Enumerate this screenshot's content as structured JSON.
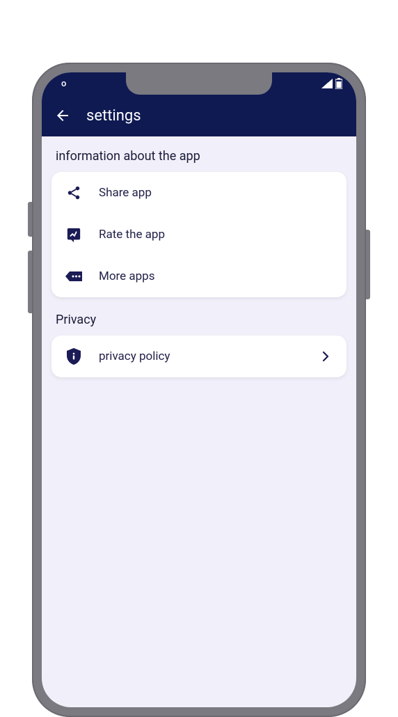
{
  "status": {
    "leftText": "o"
  },
  "header": {
    "title": "settings"
  },
  "sections": {
    "info": {
      "title": "information about the app",
      "items": {
        "share": "Share app",
        "rate": "Rate the app",
        "more": "More apps"
      }
    },
    "privacy": {
      "title": "Privacy",
      "items": {
        "policy": "privacy policy"
      }
    }
  }
}
